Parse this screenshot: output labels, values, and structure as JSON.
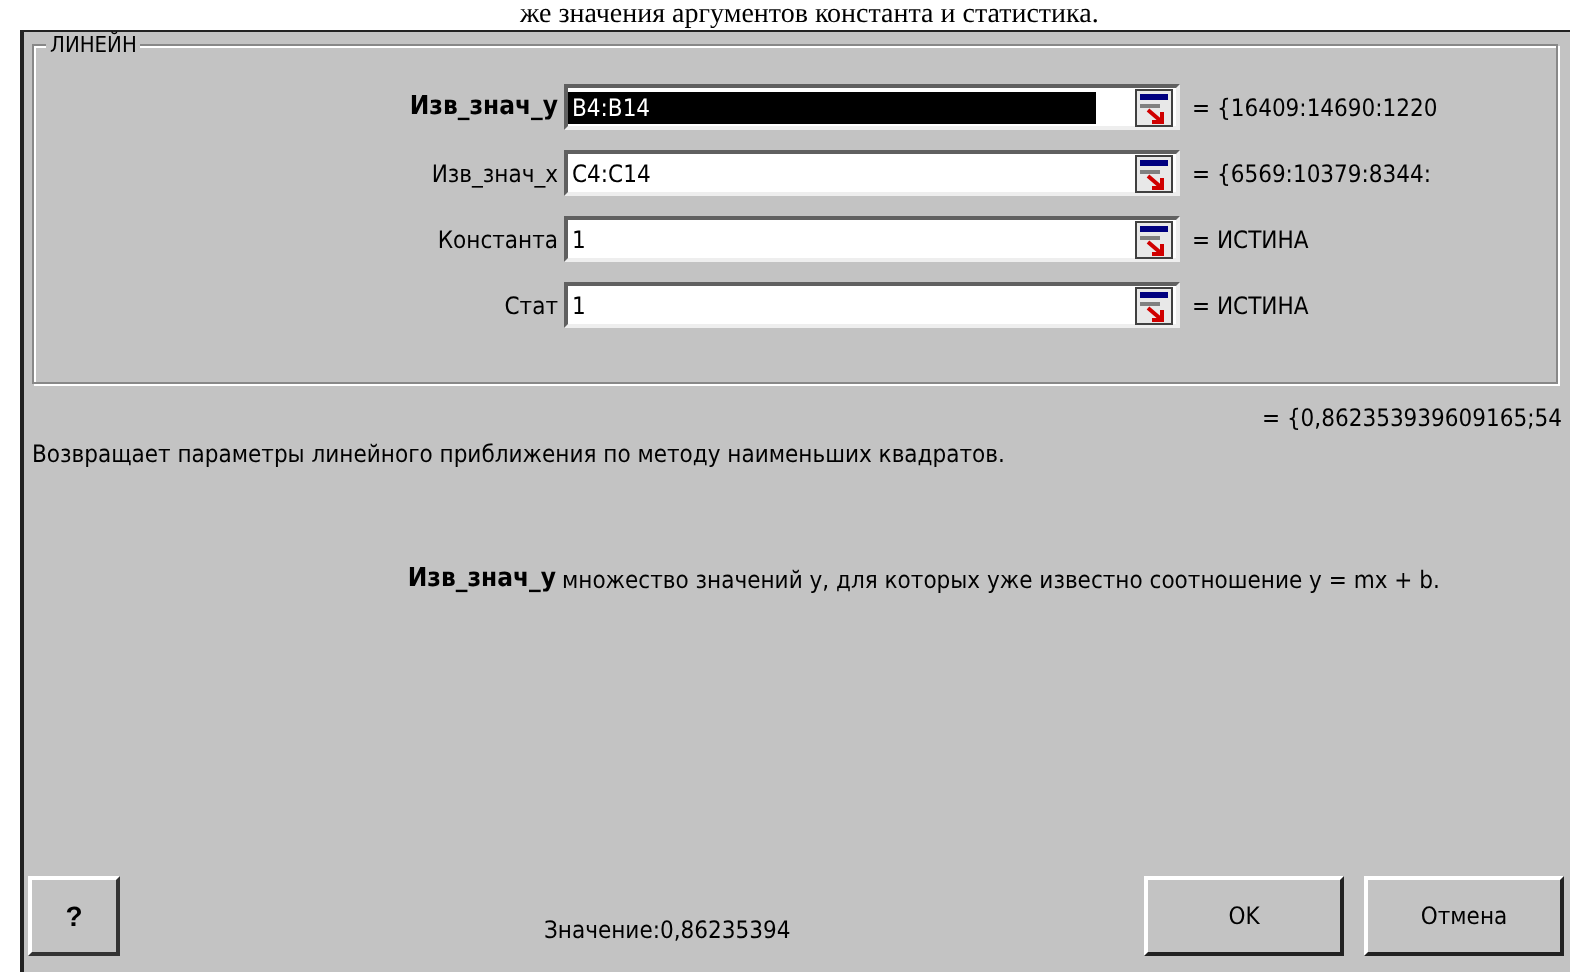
{
  "document_text": "же значения аргументов константа и статистика.",
  "dialog": {
    "group_title": "ЛИНЕЙН",
    "arguments": [
      {
        "label": "Изв_знач_у",
        "value": "B4:B14",
        "result": "= {16409:14690:1220",
        "selected": true
      },
      {
        "label": "Изв_знач_х",
        "value": "C4:C14",
        "result": "= {6569:10379:8344:",
        "selected": false
      },
      {
        "label": "Константа",
        "value": "1",
        "result": "= ИСТИНА",
        "selected": false
      },
      {
        "label": "Стат",
        "value": "1",
        "result": "= ИСТИНА",
        "selected": false
      }
    ],
    "formula_result": "= {0,862353939609165;54",
    "description": "Возвращает параметры линейного приближения по методу наименьших квадратов.",
    "argument_help": {
      "name": "Изв_знач_у",
      "text": "множество значений y, для которых уже известно соотношение y = mx + b."
    },
    "help_button": "?",
    "value_text": "Значение:0,86235394",
    "buttons": [
      "OK",
      "Отмена"
    ]
  }
}
